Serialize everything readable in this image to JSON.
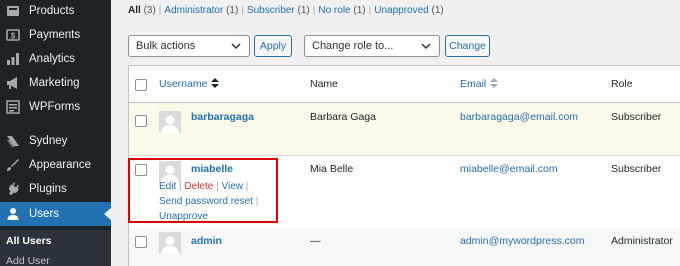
{
  "sidebar": {
    "items": [
      {
        "label": "Products",
        "icon": "products-icon"
      },
      {
        "label": "Payments",
        "icon": "payments-icon"
      },
      {
        "label": "Analytics",
        "icon": "analytics-icon"
      },
      {
        "label": "Marketing",
        "icon": "marketing-icon"
      },
      {
        "label": "WPForms",
        "icon": "wpforms-icon"
      },
      {
        "label": "Sydney",
        "icon": "sydney-icon"
      },
      {
        "label": "Appearance",
        "icon": "appearance-icon"
      },
      {
        "label": "Plugins",
        "icon": "plugins-icon"
      },
      {
        "label": "Users",
        "icon": "users-icon",
        "active": true
      }
    ],
    "submenu": [
      {
        "label": "All Users",
        "current": true
      },
      {
        "label": "Add User"
      }
    ]
  },
  "filters": {
    "all": {
      "label": "All",
      "count": "(3)"
    },
    "administrator": {
      "label": "Administrator",
      "count": "(1)"
    },
    "subscriber": {
      "label": "Subscriber",
      "count": "(1)"
    },
    "no_role": {
      "label": "No role",
      "count": "(1)"
    },
    "unapproved": {
      "label": "Unapproved",
      "count": "(1)"
    },
    "separator": "|"
  },
  "bulk": {
    "select_value": "Bulk actions",
    "apply_label": "Apply"
  },
  "role_change": {
    "select_value": "Change role to...",
    "change_label": "Change"
  },
  "table": {
    "headers": {
      "username": "Username",
      "name": "Name",
      "email": "Email",
      "role": "Role"
    },
    "rows": [
      {
        "username": "barbaragaga",
        "name": "Barbara Gaga",
        "email": "barbaragaga@email.com",
        "role": "Subscriber"
      },
      {
        "username": "miabelle",
        "name": "Mia Belle",
        "email": "miabelle@email.com",
        "role": "Subscriber",
        "actions": {
          "edit": "Edit",
          "delete": "Delete",
          "view": "View",
          "reset": "Send password reset",
          "unapprove": "Unapprove",
          "sep": "|"
        }
      },
      {
        "username": "admin",
        "name": "—",
        "email": "admin@mywordpress.com",
        "role": "Administrator"
      }
    ]
  },
  "colors": {
    "accent": "#2271b1",
    "sidebar_bg": "#1d2327",
    "highlight": "#e00000",
    "delete": "#d63638",
    "pending_row": "#fcf9e8"
  }
}
